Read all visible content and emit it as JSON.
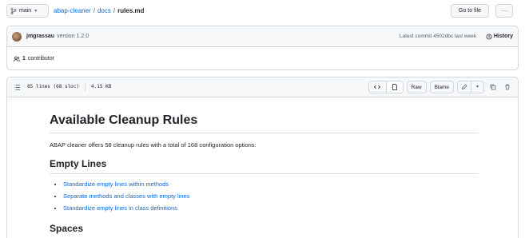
{
  "topbar": {
    "branch": "main",
    "repo": "abap-cleaner",
    "folder": "docs",
    "sep1": "/",
    "sep2": "/",
    "file": "rules.md",
    "goto_label": "Go to file",
    "more_label": "···"
  },
  "commit": {
    "author": "jmgrassau",
    "message": "version 1.2.0",
    "latest": "Latest commit 4502dbc last week",
    "history_label": "History"
  },
  "contributors": {
    "count": "1",
    "label": "contributor"
  },
  "file": {
    "lines": "85 lines (68 sloc)",
    "size": "4.15 KB",
    "raw_label": "Raw",
    "blame_label": "Blame"
  },
  "content": {
    "title": "Available Cleanup Rules",
    "intro": "ABAP cleaner offers 58 cleanup rules with a total of 168 configuration options:",
    "section1": "Empty Lines",
    "rules": [
      "Standardize empty lines within methods",
      "Separate methods and classes with empty lines",
      "Standardize empty lines in class definitions"
    ],
    "section2": "Spaces"
  },
  "colors": {
    "link": "#0969da",
    "border": "#d0d7de",
    "header_bg": "#f6f8fa"
  }
}
